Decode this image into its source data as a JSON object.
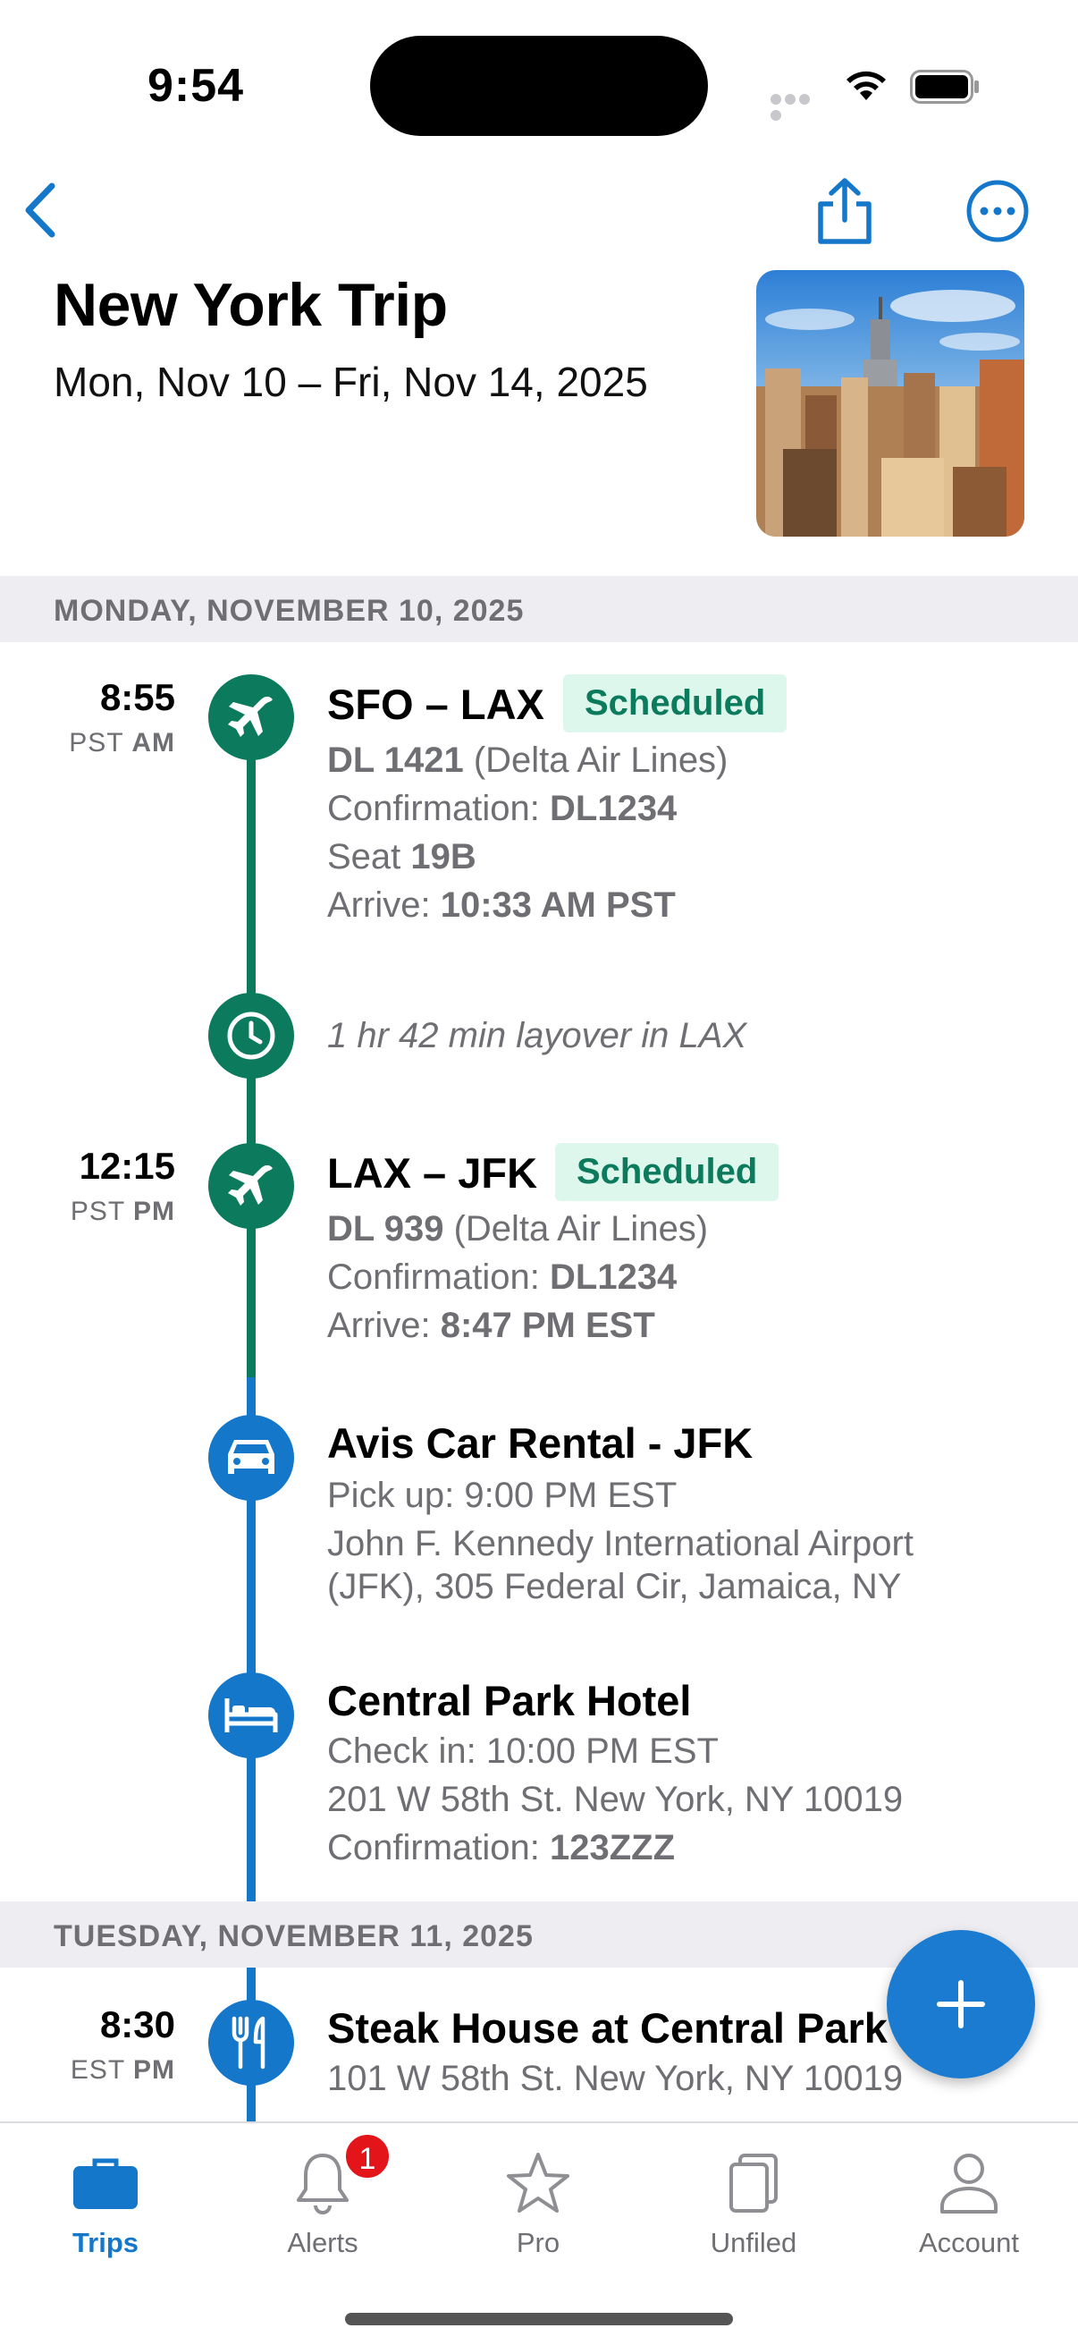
{
  "status_bar": {
    "time": "9:54"
  },
  "header": {
    "title": "New York Trip",
    "dates": "Mon, Nov 10 – Fri, Nov 14, 2025"
  },
  "colors": {
    "green": "#0c7a5c",
    "blue": "#1477c9",
    "badge_bg": "#def7ec"
  },
  "days": [
    {
      "label": "MONDAY, NOVEMBER 10, 2025"
    },
    {
      "label": "TUESDAY, NOVEMBER 11, 2025"
    }
  ],
  "events": {
    "flight1": {
      "time": "8:55",
      "zone": "PST",
      "ampm": "AM",
      "route": "SFO – LAX",
      "status": "Scheduled",
      "flight_no": "DL 1421",
      "airline": "(Delta Air Lines)",
      "conf_label": "Confirmation:",
      "conf": "DL1234",
      "seat_label": "Seat",
      "seat": "19B",
      "arrive_label": "Arrive:",
      "arrive": "10:33 AM PST"
    },
    "layover": {
      "text": "1 hr 42 min layover in LAX"
    },
    "flight2": {
      "time": "12:15",
      "zone": "PST",
      "ampm": "PM",
      "route": "LAX – JFK",
      "status": "Scheduled",
      "flight_no": "DL 939",
      "airline": "(Delta Air Lines)",
      "conf_label": "Confirmation:",
      "conf": "DL1234",
      "arrive_label": "Arrive:",
      "arrive": "8:47 PM EST"
    },
    "car": {
      "title": "Avis Car Rental - JFK",
      "pickup": "Pick up: 9:00 PM EST",
      "address1": "John F. Kennedy International Airport",
      "address2": "(JFK), 305 Federal Cir, Jamaica, NY"
    },
    "hotel": {
      "title": "Central Park Hotel",
      "checkin": "Check in: 10:00 PM EST",
      "address": "201 W 58th St. New York, NY 10019",
      "conf_label": "Confirmation:",
      "conf": "123ZZZ"
    },
    "dinner": {
      "time": "8:30",
      "zone": "EST",
      "ampm": "PM",
      "title": "Steak House at Central Park",
      "address": "101 W 58th St. New York, NY 10019"
    }
  },
  "tabbar": {
    "tabs": [
      {
        "label": "Trips",
        "icon": "briefcase-icon",
        "active": true
      },
      {
        "label": "Alerts",
        "icon": "bell-icon",
        "badge": "1"
      },
      {
        "label": "Pro",
        "icon": "star-icon"
      },
      {
        "label": "Unfiled",
        "icon": "documents-icon"
      },
      {
        "label": "Account",
        "icon": "person-icon"
      }
    ]
  }
}
